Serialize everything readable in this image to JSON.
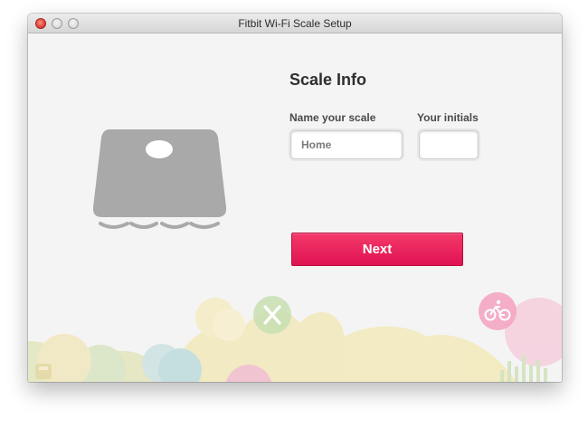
{
  "window": {
    "title": "Fitbit Wi-Fi Scale Setup"
  },
  "form": {
    "heading": "Scale Info",
    "name_label": "Name your scale",
    "name_placeholder": "Home",
    "name_value": "",
    "initials_label": "Your initials",
    "initials_value": ""
  },
  "actions": {
    "next_label": "Next"
  },
  "colors": {
    "accent": "#e8185a",
    "scale_gray": "#a9a9a9"
  },
  "icons": [
    "scale-illustration",
    "fork-knife-icon",
    "bicycle-icon",
    "small-scale-icon"
  ]
}
